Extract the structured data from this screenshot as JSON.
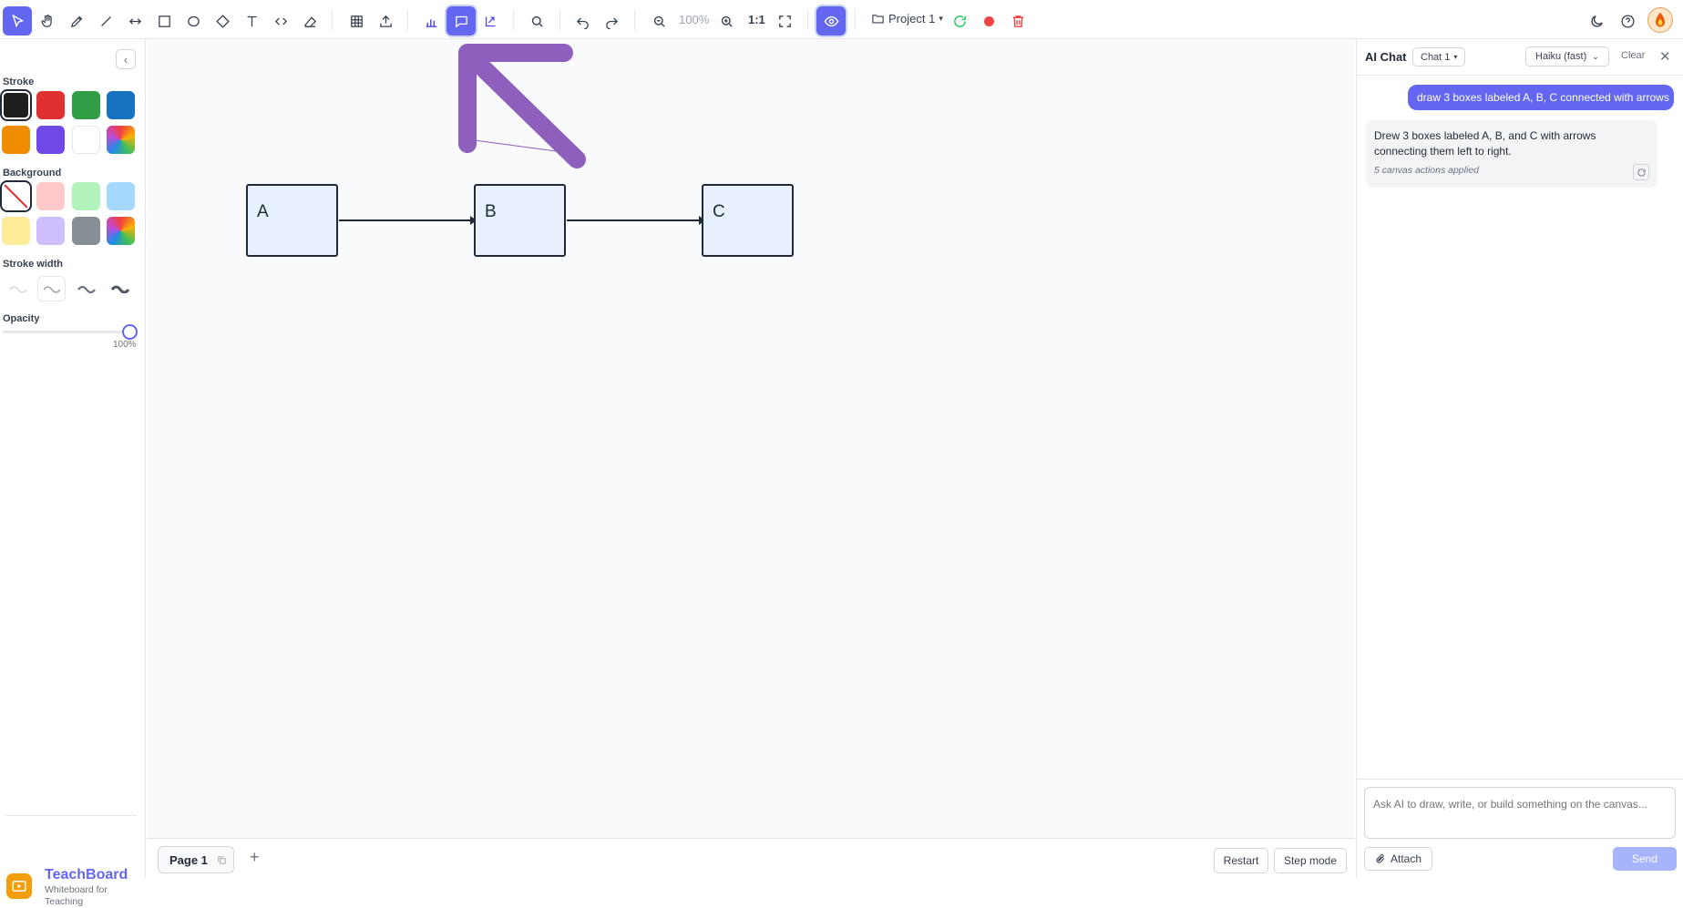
{
  "toolbar": {
    "zoom_level": "100%",
    "ratio_label": "1:1",
    "project_name": "Project 1",
    "icons": [
      "select-icon",
      "hand-icon",
      "pencil-icon",
      "line-icon",
      "arrow-icon",
      "rectangle-icon",
      "ellipse-icon",
      "diamond-icon",
      "text-icon",
      "code-icon",
      "eraser-icon",
      "table-icon",
      "upload-icon",
      "chart-icon",
      "chat-icon",
      "share-icon",
      "search-icon",
      "undo-icon",
      "redo-icon",
      "zoom-out-icon",
      "zoom-in-icon",
      "fullscreen-icon",
      "eye-icon",
      "folder-icon",
      "refresh-icon",
      "record-icon",
      "trash-icon",
      "moon-icon",
      "help-icon"
    ]
  },
  "leftpanel": {
    "stroke_label": "Stroke",
    "background_label": "Background",
    "stroke_width_label": "Stroke width",
    "opacity_label": "Opacity",
    "opacity_value": "100%",
    "opacity_level": 1.0,
    "stroke_colors": [
      "#1f1f1f",
      "#e03131",
      "#2f9e44",
      "#1971c2",
      "#f08c00",
      "#7048e8",
      "#ffffff",
      "gradient"
    ],
    "background_colors": [
      "transparent",
      "#ffc9c9",
      "#b2f2bb",
      "#a5d8ff",
      "#ffec99",
      "#d0bfff",
      "#868e96",
      "gradient"
    ],
    "brand_name": "TeachBoard",
    "brand_tagline": "Whiteboard for Teaching"
  },
  "canvas": {
    "boxes": [
      {
        "label": "A"
      },
      {
        "label": "B"
      },
      {
        "label": "C"
      }
    ],
    "arrow_color": "#8e5fbd"
  },
  "bottombar": {
    "page_label": "Page 1",
    "add_page": "+",
    "restart_label": "Restart",
    "step_mode_label": "Step mode"
  },
  "chat": {
    "title": "AI Chat",
    "tab_label": "Chat 1",
    "model": "Haiku (fast)",
    "clear_label": "Clear",
    "close_glyph": "✕",
    "user_message": "draw 3 boxes labeled A, B, C connected with arrows",
    "ai_message": "Drew 3 boxes labeled A, B, and C with arrows connecting them left to right.",
    "ai_meta": "5 canvas actions applied",
    "input_placeholder": "Ask AI to draw, write, or build something on the canvas...",
    "attach_label": "Attach",
    "send_label": "Send"
  },
  "colors": {
    "accent": "#6366f1",
    "canvas_bg": "#f8fafc",
    "box_fill": "#e8effd"
  }
}
